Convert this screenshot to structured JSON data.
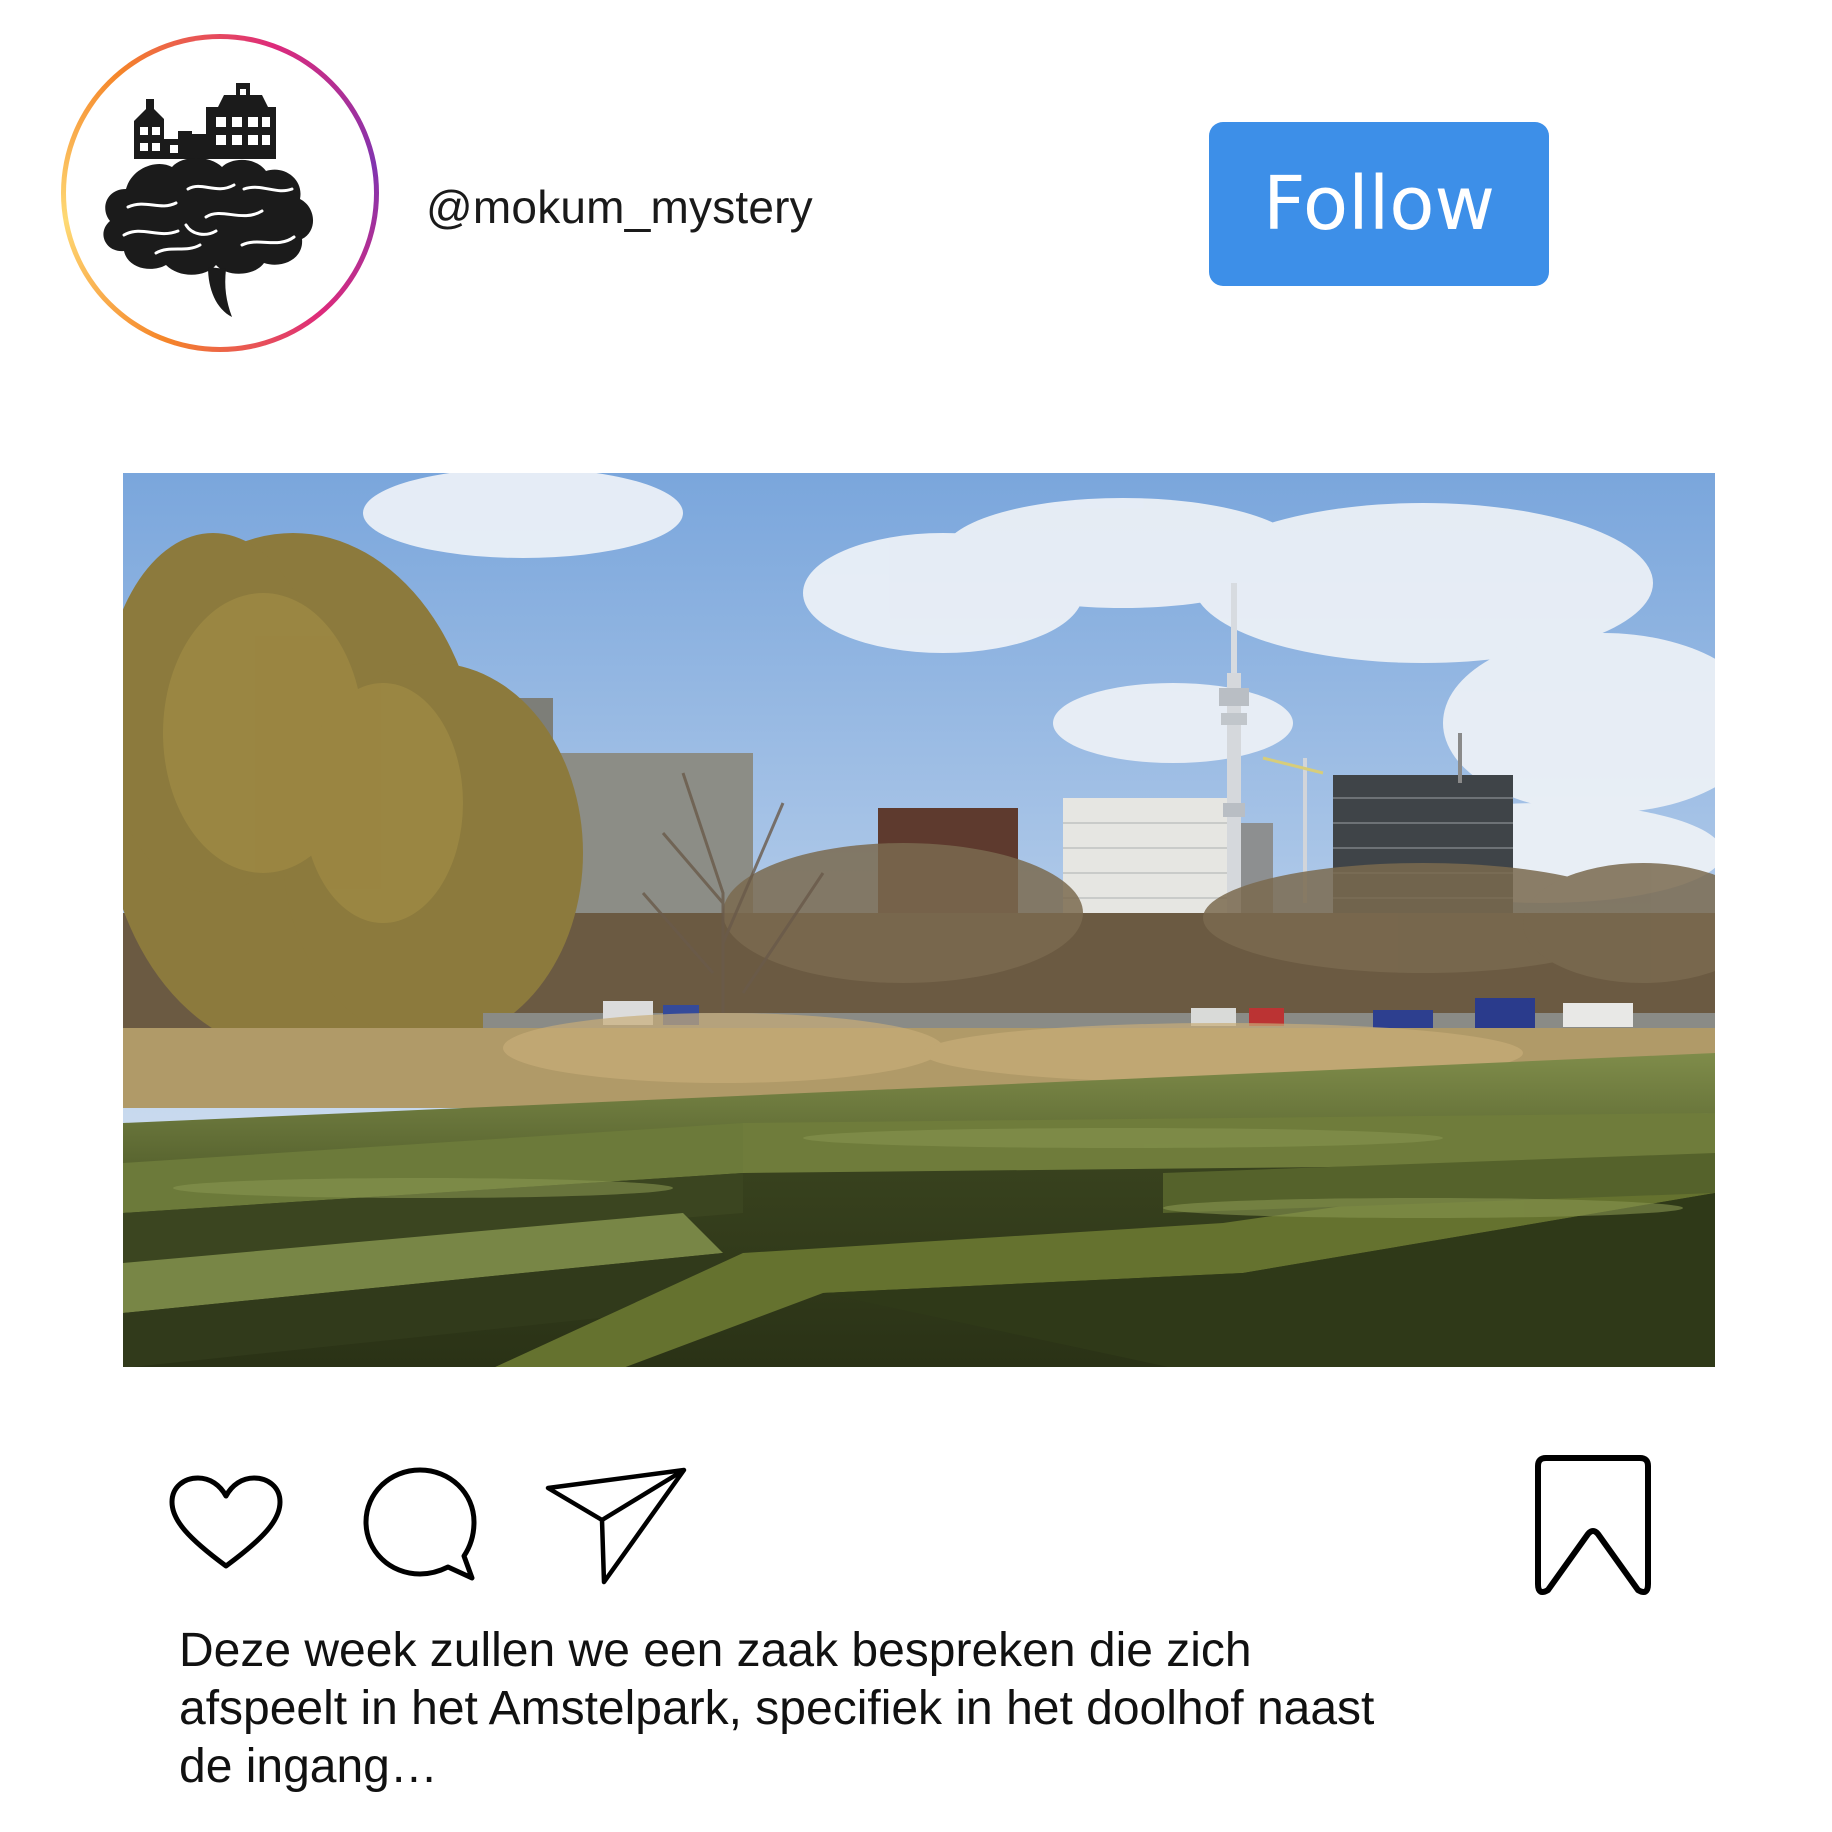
{
  "profile": {
    "username": "@mokum_mystery",
    "avatar_icon": "city-brain-logo-icon"
  },
  "header": {
    "follow_label": "Follow"
  },
  "colors": {
    "follow_button": "#3d8fe8",
    "ring_gradient": [
      "#f58529",
      "#dd2a7b",
      "#8134af"
    ]
  },
  "actions": {
    "like_icon": "heart-icon",
    "comment_icon": "comment-bubble-icon",
    "share_icon": "paper-plane-icon",
    "save_icon": "bookmark-icon"
  },
  "caption": {
    "text": "Deze week zullen we een zaak bespreken die zich afspeelt in het Amstelpark, specifiek in het doolhof naast de ingang…"
  }
}
